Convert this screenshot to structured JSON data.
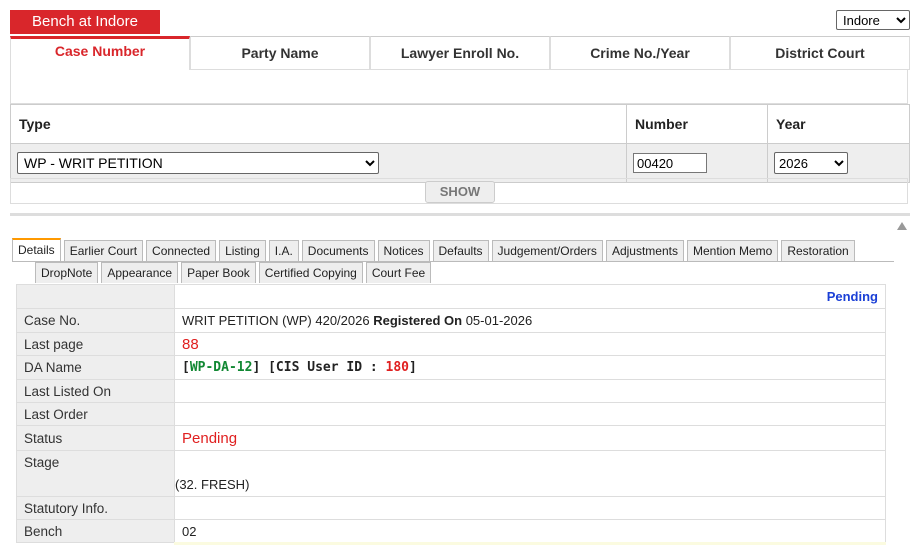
{
  "bench": {
    "label": "Bench at Indore",
    "select_value": "Indore"
  },
  "top_tabs": [
    {
      "label": "Case Number"
    },
    {
      "label": "Party Name"
    },
    {
      "label": "Lawyer Enroll No."
    },
    {
      "label": "Crime No./Year"
    },
    {
      "label": "District Court"
    }
  ],
  "form": {
    "type_header": "Type",
    "number_header": "Number",
    "year_header": "Year",
    "type_value": "WP - WRIT PETITION",
    "number_value": "00420",
    "year_value": "2026",
    "show_label": "SHOW"
  },
  "sub_tabs_row1": [
    "Details",
    "Earlier Court",
    "Connected",
    "Listing",
    "I.A.",
    "Documents",
    "Notices",
    "Defaults",
    "Judgement/Orders",
    "Adjustments",
    "Mention Memo",
    "Restoration"
  ],
  "sub_tabs_row2": [
    "DropNote",
    "Appearance",
    "Paper Book",
    "Certified Copying",
    "Court Fee"
  ],
  "details": {
    "status_header": "Pending",
    "case_no_label": "Case No.",
    "case_no_text": "WRIT PETITION (WP) 420/2026",
    "registered_label": "Registered On",
    "registered_date": "05-01-2026",
    "last_page_label": "Last page",
    "last_page_value": "88",
    "da_label": "DA Name",
    "da_open": "[",
    "da_code": "WP-DA-12",
    "da_mid": "] [CIS User ID :",
    "da_user": "180",
    "da_close": "]",
    "last_listed_label": "Last Listed On",
    "last_listed_value": "",
    "last_order_label": "Last Order",
    "last_order_value": "",
    "status_label": "Status",
    "status_value": "Pending",
    "stage_label": "Stage",
    "stage_value": "(32. FRESH)",
    "statutory_label": "Statutory Info.",
    "statutory_value": "",
    "bench_label": "Bench",
    "bench_value": "02"
  }
}
